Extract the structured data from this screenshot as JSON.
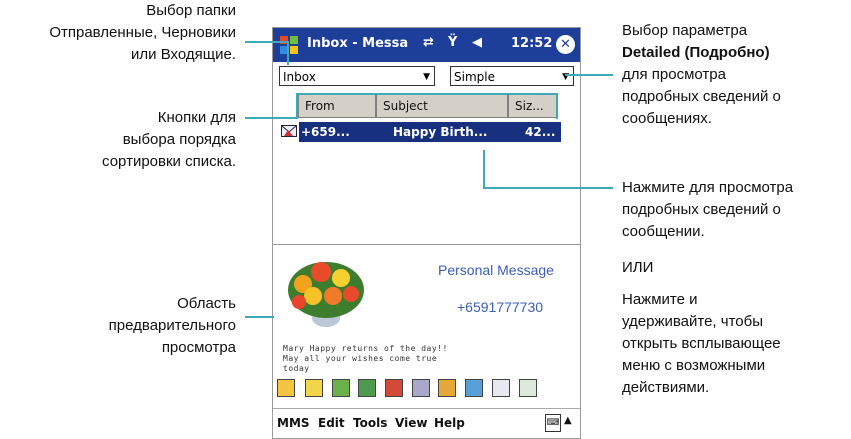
{
  "annotations": {
    "folder_select": [
      "Выбор папки",
      "Отправленные, Черновики",
      "или Входящие."
    ],
    "sort_buttons": [
      "Кнопки для",
      "выбора порядка",
      "сортировки списка."
    ],
    "preview_area": [
      "Область",
      "предварительного",
      "просмотра"
    ],
    "detailed_param": {
      "line1": "Выбор параметра",
      "line2_bold": "Detailed (Подробно)",
      "line3": "для просмотра",
      "line4": "подробных сведений о",
      "line5": "сообщениях."
    },
    "tap_message": [
      "Нажмите для просмотра",
      "подробных сведений о",
      "сообщении."
    ],
    "or_label": "ИЛИ",
    "hold_message": [
      "Нажмите и",
      "удерживайте, чтобы",
      "открыть всплывающее",
      "меню с возможными",
      "действиями."
    ]
  },
  "device": {
    "title": "Inbox - Messa",
    "time": "12:52",
    "folder_combo": "Inbox",
    "view_combo": "Simple",
    "columns": [
      "From",
      "Subject",
      "Siz..."
    ],
    "message": {
      "from": "+659...",
      "subject": "Happy Birth...",
      "size": "42..."
    },
    "preview": {
      "title": "Personal Message",
      "number": "+6591777730",
      "text": "Mary Happy returns of the day!! May all your wishes come true today"
    },
    "menu": [
      "MMS",
      "Edit",
      "Tools",
      "View",
      "Help"
    ]
  },
  "colors": {
    "titlebar": "#1d3f9a",
    "selection": "#16307e",
    "leader_lines": "#3fa9b6",
    "preview_text": "#3b5fb5"
  }
}
